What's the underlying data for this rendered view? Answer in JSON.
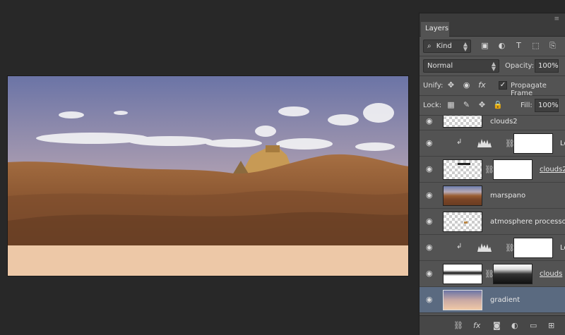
{
  "panel": {
    "tab_label": "Layers",
    "filter": {
      "kind_label": "Kind"
    },
    "blend": {
      "mode": "Normal",
      "opacity_label": "Opacity:",
      "opacity_value": "100%"
    },
    "unify": {
      "label": "Unify:",
      "propagate_label": "Propagate Frame"
    },
    "lock": {
      "label": "Lock:",
      "fill_label": "Fill:",
      "fill_value": "100%"
    }
  },
  "layers": [
    {
      "name": "clouds2",
      "type": "pixel",
      "partial": true
    },
    {
      "name": "Le",
      "type": "levels-adjustment",
      "clipped": true
    },
    {
      "name": "clouds2",
      "type": "pixel-masked"
    },
    {
      "name": "marspano",
      "type": "pixel"
    },
    {
      "name": "atmosphere processor",
      "type": "pixel"
    },
    {
      "name": "Le",
      "type": "levels-adjustment",
      "clipped": true
    },
    {
      "name": "clouds",
      "type": "pixel-masked"
    },
    {
      "name": "gradient",
      "type": "pixel",
      "selected": true
    }
  ],
  "colors": {
    "selected_row": "#5a6a80",
    "panel_bg": "#535353",
    "workspace_bg": "#282828"
  }
}
